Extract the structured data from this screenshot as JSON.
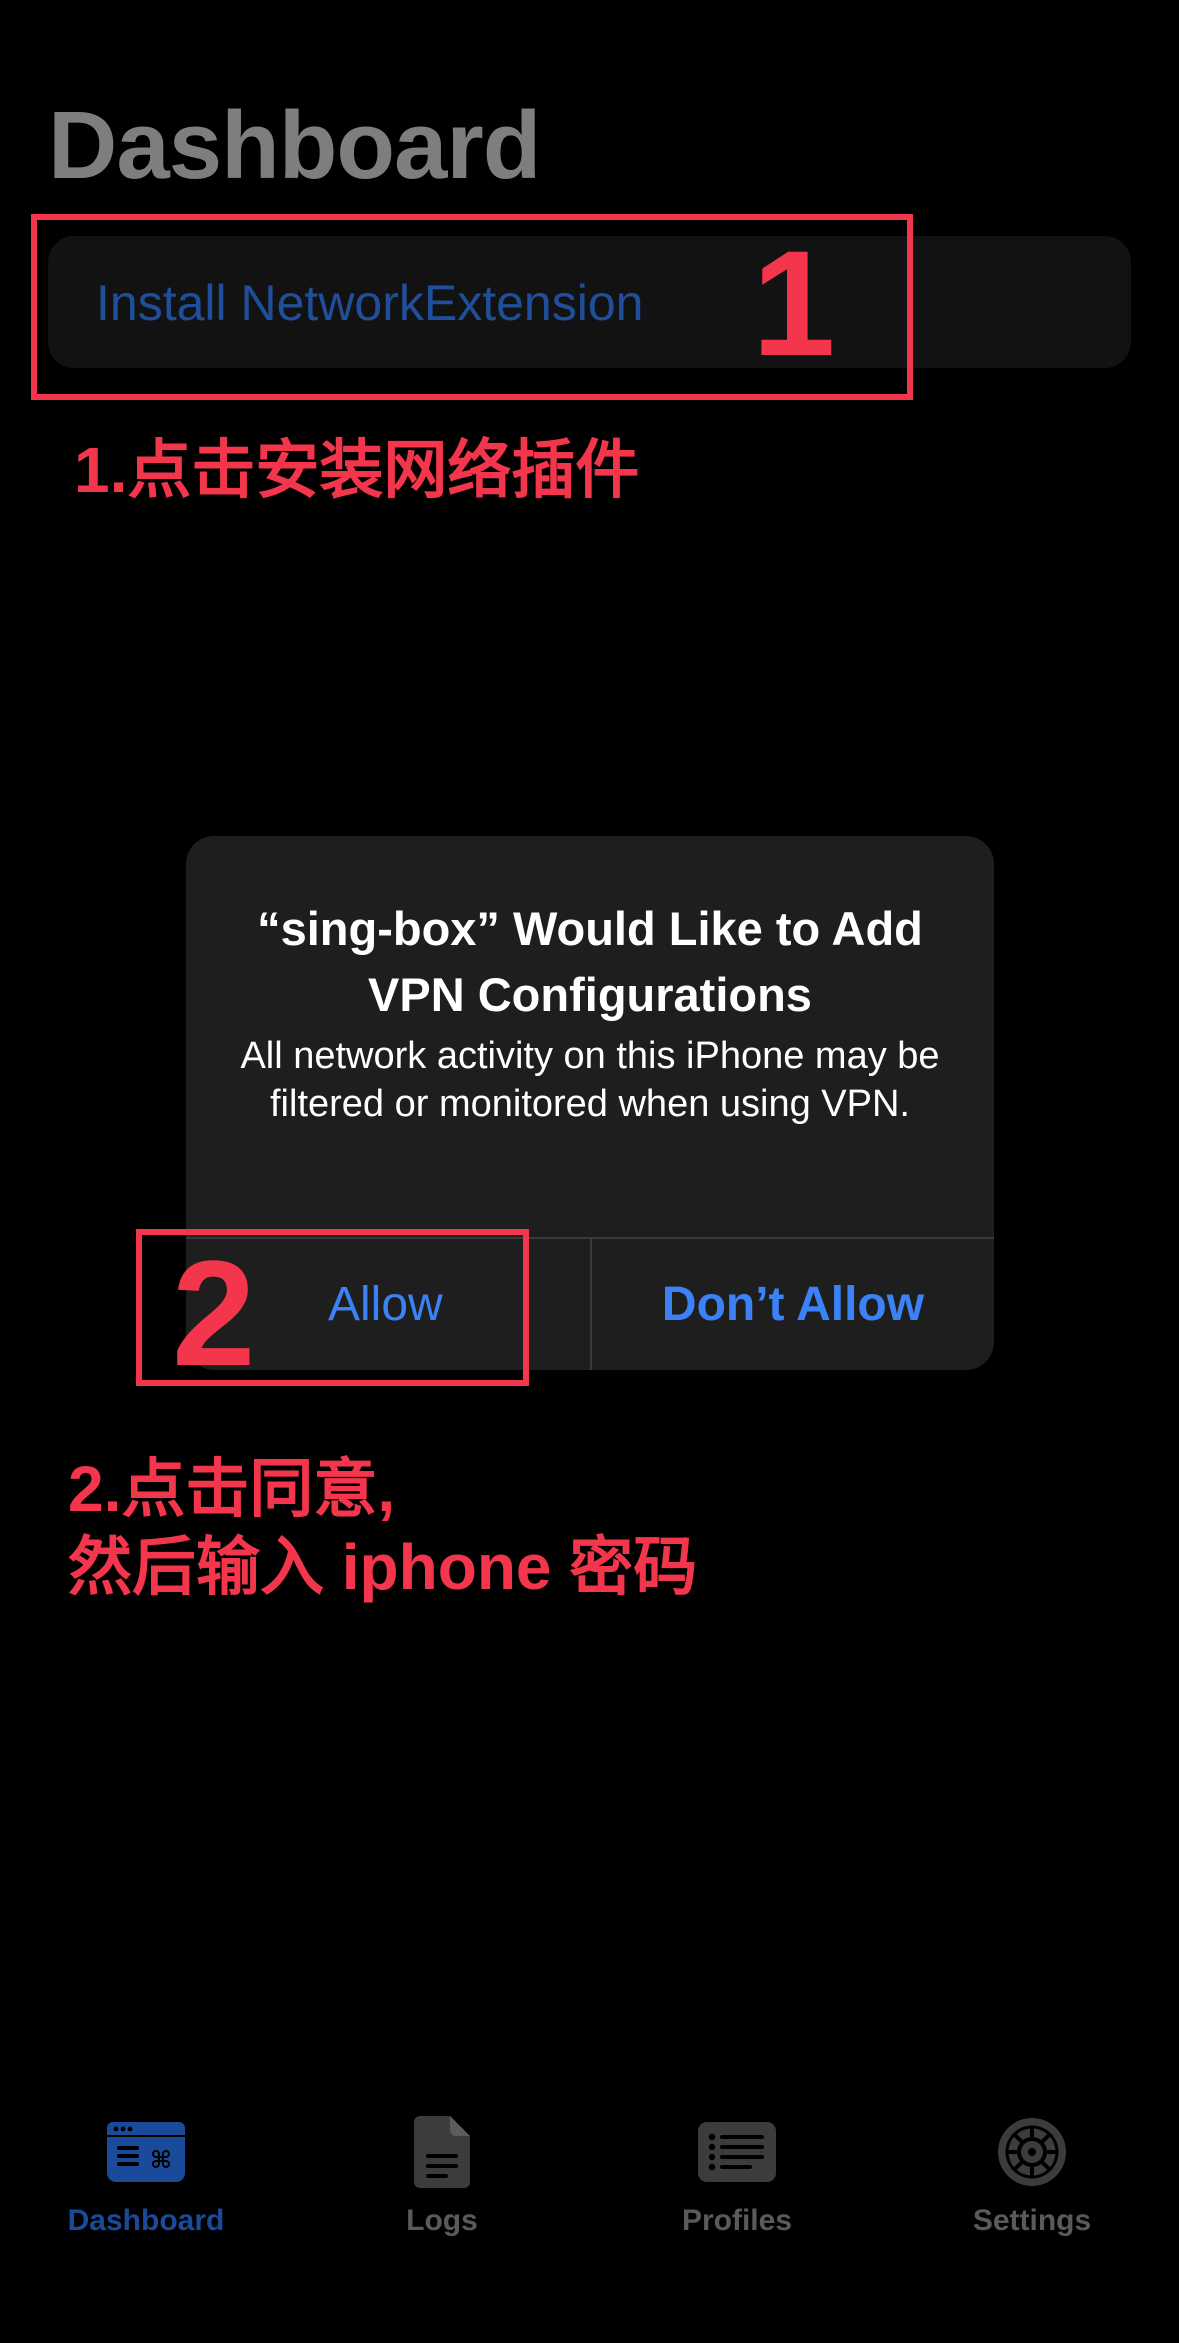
{
  "header": {
    "title": "Dashboard"
  },
  "install_card": {
    "label": "Install NetworkExtension"
  },
  "annotations": {
    "step1_number": "1",
    "step1_text": "1.点击安装网络插件",
    "step2_number": "2",
    "step2_line1": "2.点击同意,",
    "step2_line2": "然后输入 iphone 密码"
  },
  "alert": {
    "title": "“sing-box” Would Like to Add VPN Configurations",
    "message": "All network activity on this iPhone may be filtered or monitored when using VPN.",
    "allow_label": "Allow",
    "deny_label": "Don’t Allow"
  },
  "tab_bar": {
    "items": [
      {
        "label": "Dashboard",
        "icon": "dashboard-icon",
        "active": true
      },
      {
        "label": "Logs",
        "icon": "document-icon",
        "active": false
      },
      {
        "label": "Profiles",
        "icon": "list-icon",
        "active": false
      },
      {
        "label": "Settings",
        "icon": "gear-icon",
        "active": false
      }
    ]
  },
  "colors": {
    "background": "#000000",
    "annotation_red": "#f4364c",
    "link_blue": "#3b82f6",
    "active_tab_blue": "#1a4b9a",
    "inactive_tab_gray": "#5a5a5a"
  }
}
